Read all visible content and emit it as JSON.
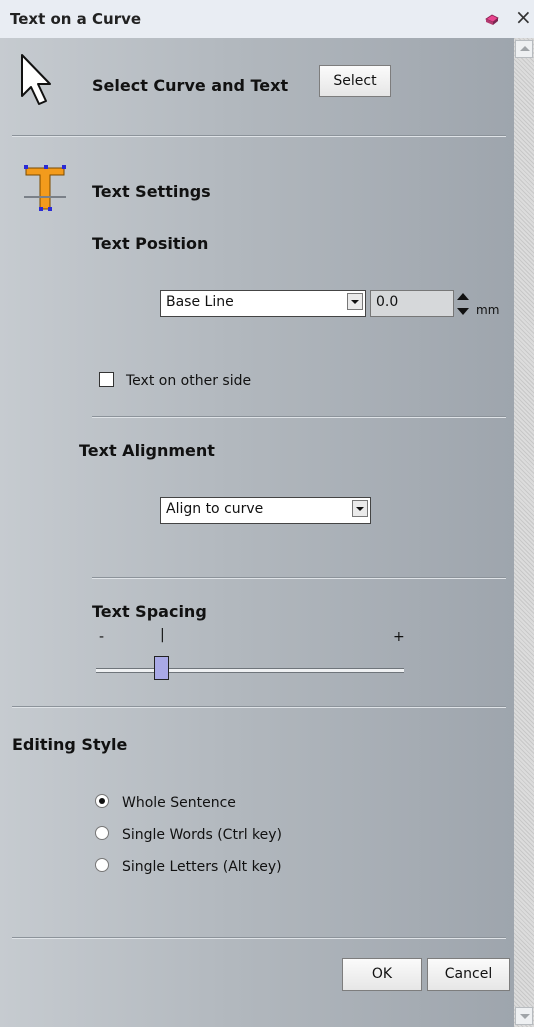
{
  "window": {
    "title": "Text on a Curve",
    "pin_icon": "pin-icon",
    "close_icon": "close-icon"
  },
  "select_section": {
    "label": "Select Curve and Text",
    "button": "Select",
    "icon": "cursor-arrow-icon"
  },
  "text_settings": {
    "heading": "Text Settings",
    "icon": "text-t-icon",
    "position": {
      "heading": "Text Position",
      "dropdown_value": "Base Line",
      "offset_value": "0.0",
      "unit": "mm"
    },
    "other_side": {
      "label": "Text on other side",
      "checked": false
    }
  },
  "alignment": {
    "heading": "Text Alignment",
    "dropdown_value": "Align to curve"
  },
  "spacing": {
    "heading": "Text Spacing",
    "minus": "-",
    "mid_tick": "|",
    "plus": "+",
    "slider_fraction": 0.2
  },
  "editing_style": {
    "heading": "Editing Style",
    "options": [
      {
        "label": "Whole Sentence",
        "selected": true
      },
      {
        "label": "Single Words (Ctrl key)",
        "selected": false
      },
      {
        "label": "Single Letters (Alt key)",
        "selected": false
      }
    ]
  },
  "footer": {
    "ok": "OK",
    "cancel": "Cancel"
  },
  "colors": {
    "panel_gradient_start": "#c6cbd0",
    "panel_gradient_end": "#9ea5ad",
    "title_bar": "#e9edf3"
  }
}
